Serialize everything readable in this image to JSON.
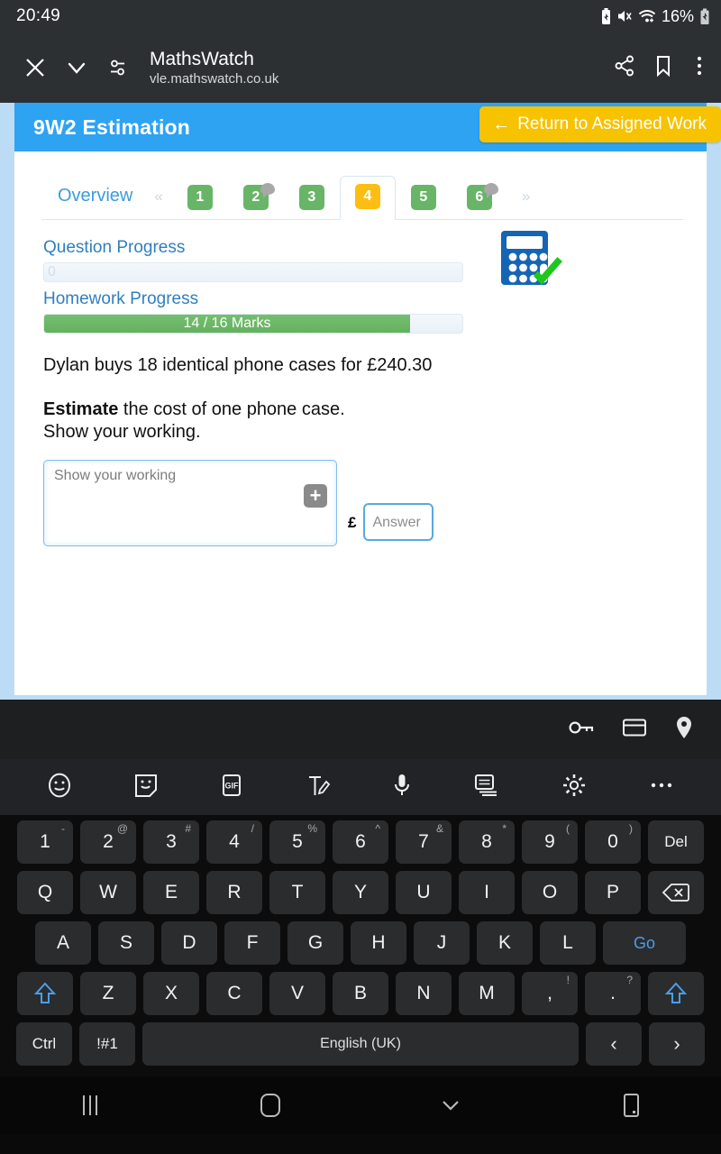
{
  "statusbar": {
    "clock": "20:49",
    "battery_percent": "16%",
    "icons": [
      "battery-saver-icon",
      "volume-mute-icon",
      "wifi-icon",
      "charging-battery-icon"
    ]
  },
  "browser": {
    "close_icon": "close-icon",
    "collapse_icon": "chevron-down-icon",
    "page_info_icon": "page-settings-icon",
    "title": "MathsWatch",
    "url": "vle.mathswatch.co.uk",
    "share_icon": "share-icon",
    "bookmark_icon": "bookmark-icon",
    "menu_icon": "more-vertical-icon"
  },
  "page": {
    "banner_title": "9W2 Estimation",
    "return_button": "Return to Assigned Work",
    "return_arrow": "←",
    "accent_blue": "#2ea3f2",
    "accent_yellow": "#f7c200",
    "tabs": {
      "overview_label": "Overview",
      "prev_chevron": "«",
      "next_chevron": "»",
      "items": [
        {
          "label": "1",
          "state": "done",
          "comment": false
        },
        {
          "label": "2",
          "state": "done",
          "comment": true
        },
        {
          "label": "3",
          "state": "done",
          "comment": false
        },
        {
          "label": "4",
          "state": "current",
          "comment": false
        },
        {
          "label": "5",
          "state": "done",
          "comment": false
        },
        {
          "label": "6",
          "state": "done",
          "comment": true
        }
      ]
    },
    "question_progress": {
      "label": "Question Progress",
      "value_label": "0",
      "percent": 0
    },
    "homework_progress": {
      "label": "Homework Progress",
      "value_label": "14 / 16 Marks",
      "marks_earned": 14,
      "marks_total": 16,
      "percent": 87.5
    },
    "calculator_icon": "calculator-allowed-icon",
    "question_text": "Dylan buys 18 identical phone cases for £240.30",
    "instruction_bold": "Estimate",
    "instruction_rest": " the cost of one phone case.",
    "instruction_line2": "Show your working.",
    "working_placeholder": "Show your working",
    "working_value": "",
    "add_icon": "plus-icon",
    "currency_symbol": "£",
    "answer_placeholder": "Answer",
    "answer_value": ""
  },
  "keyboard": {
    "suggest_icons": [
      "password-key-icon",
      "credit-card-icon",
      "location-pin-icon"
    ],
    "tool_icons": [
      "emoji-icon",
      "sticker-icon",
      "gif-icon",
      "handwriting-icon",
      "microphone-icon",
      "clipboard-icon",
      "settings-gear-icon",
      "more-options-icon"
    ],
    "row_numbers": [
      {
        "main": "1",
        "alt": "-"
      },
      {
        "main": "2",
        "alt": "@"
      },
      {
        "main": "3",
        "alt": "#"
      },
      {
        "main": "4",
        "alt": "/"
      },
      {
        "main": "5",
        "alt": "%"
      },
      {
        "main": "6",
        "alt": "^"
      },
      {
        "main": "7",
        "alt": "&"
      },
      {
        "main": "8",
        "alt": "*"
      },
      {
        "main": "9",
        "alt": "("
      },
      {
        "main": "0",
        "alt": ")"
      }
    ],
    "delete_label": "Del",
    "row_top": [
      "Q",
      "W",
      "E",
      "R",
      "T",
      "Y",
      "U",
      "I",
      "O",
      "P"
    ],
    "backspace_icon": "backspace-icon",
    "row_home": [
      "A",
      "S",
      "D",
      "F",
      "G",
      "H",
      "J",
      "K",
      "L"
    ],
    "go_label": "Go",
    "row_bottom": [
      {
        "main": "Z",
        "alt": ""
      },
      {
        "main": "X",
        "alt": ""
      },
      {
        "main": "C",
        "alt": ""
      },
      {
        "main": "V",
        "alt": ""
      },
      {
        "main": "B",
        "alt": ""
      },
      {
        "main": "N",
        "alt": ""
      },
      {
        "main": "M",
        "alt": ""
      },
      {
        "main": ",",
        "alt": "!"
      },
      {
        "main": ".",
        "alt": "?"
      }
    ],
    "shift_icon": "shift-up-icon",
    "ctrl_label": "Ctrl",
    "symbols_label": "!#1",
    "space_label": "English (UK)",
    "arrow_left": "‹",
    "arrow_right": "›"
  },
  "navbar": {
    "recents_icon": "recents-icon",
    "home_icon": "home-icon",
    "back_icon": "hide-keyboard-chevron-icon",
    "device_icon": "device-icon"
  }
}
